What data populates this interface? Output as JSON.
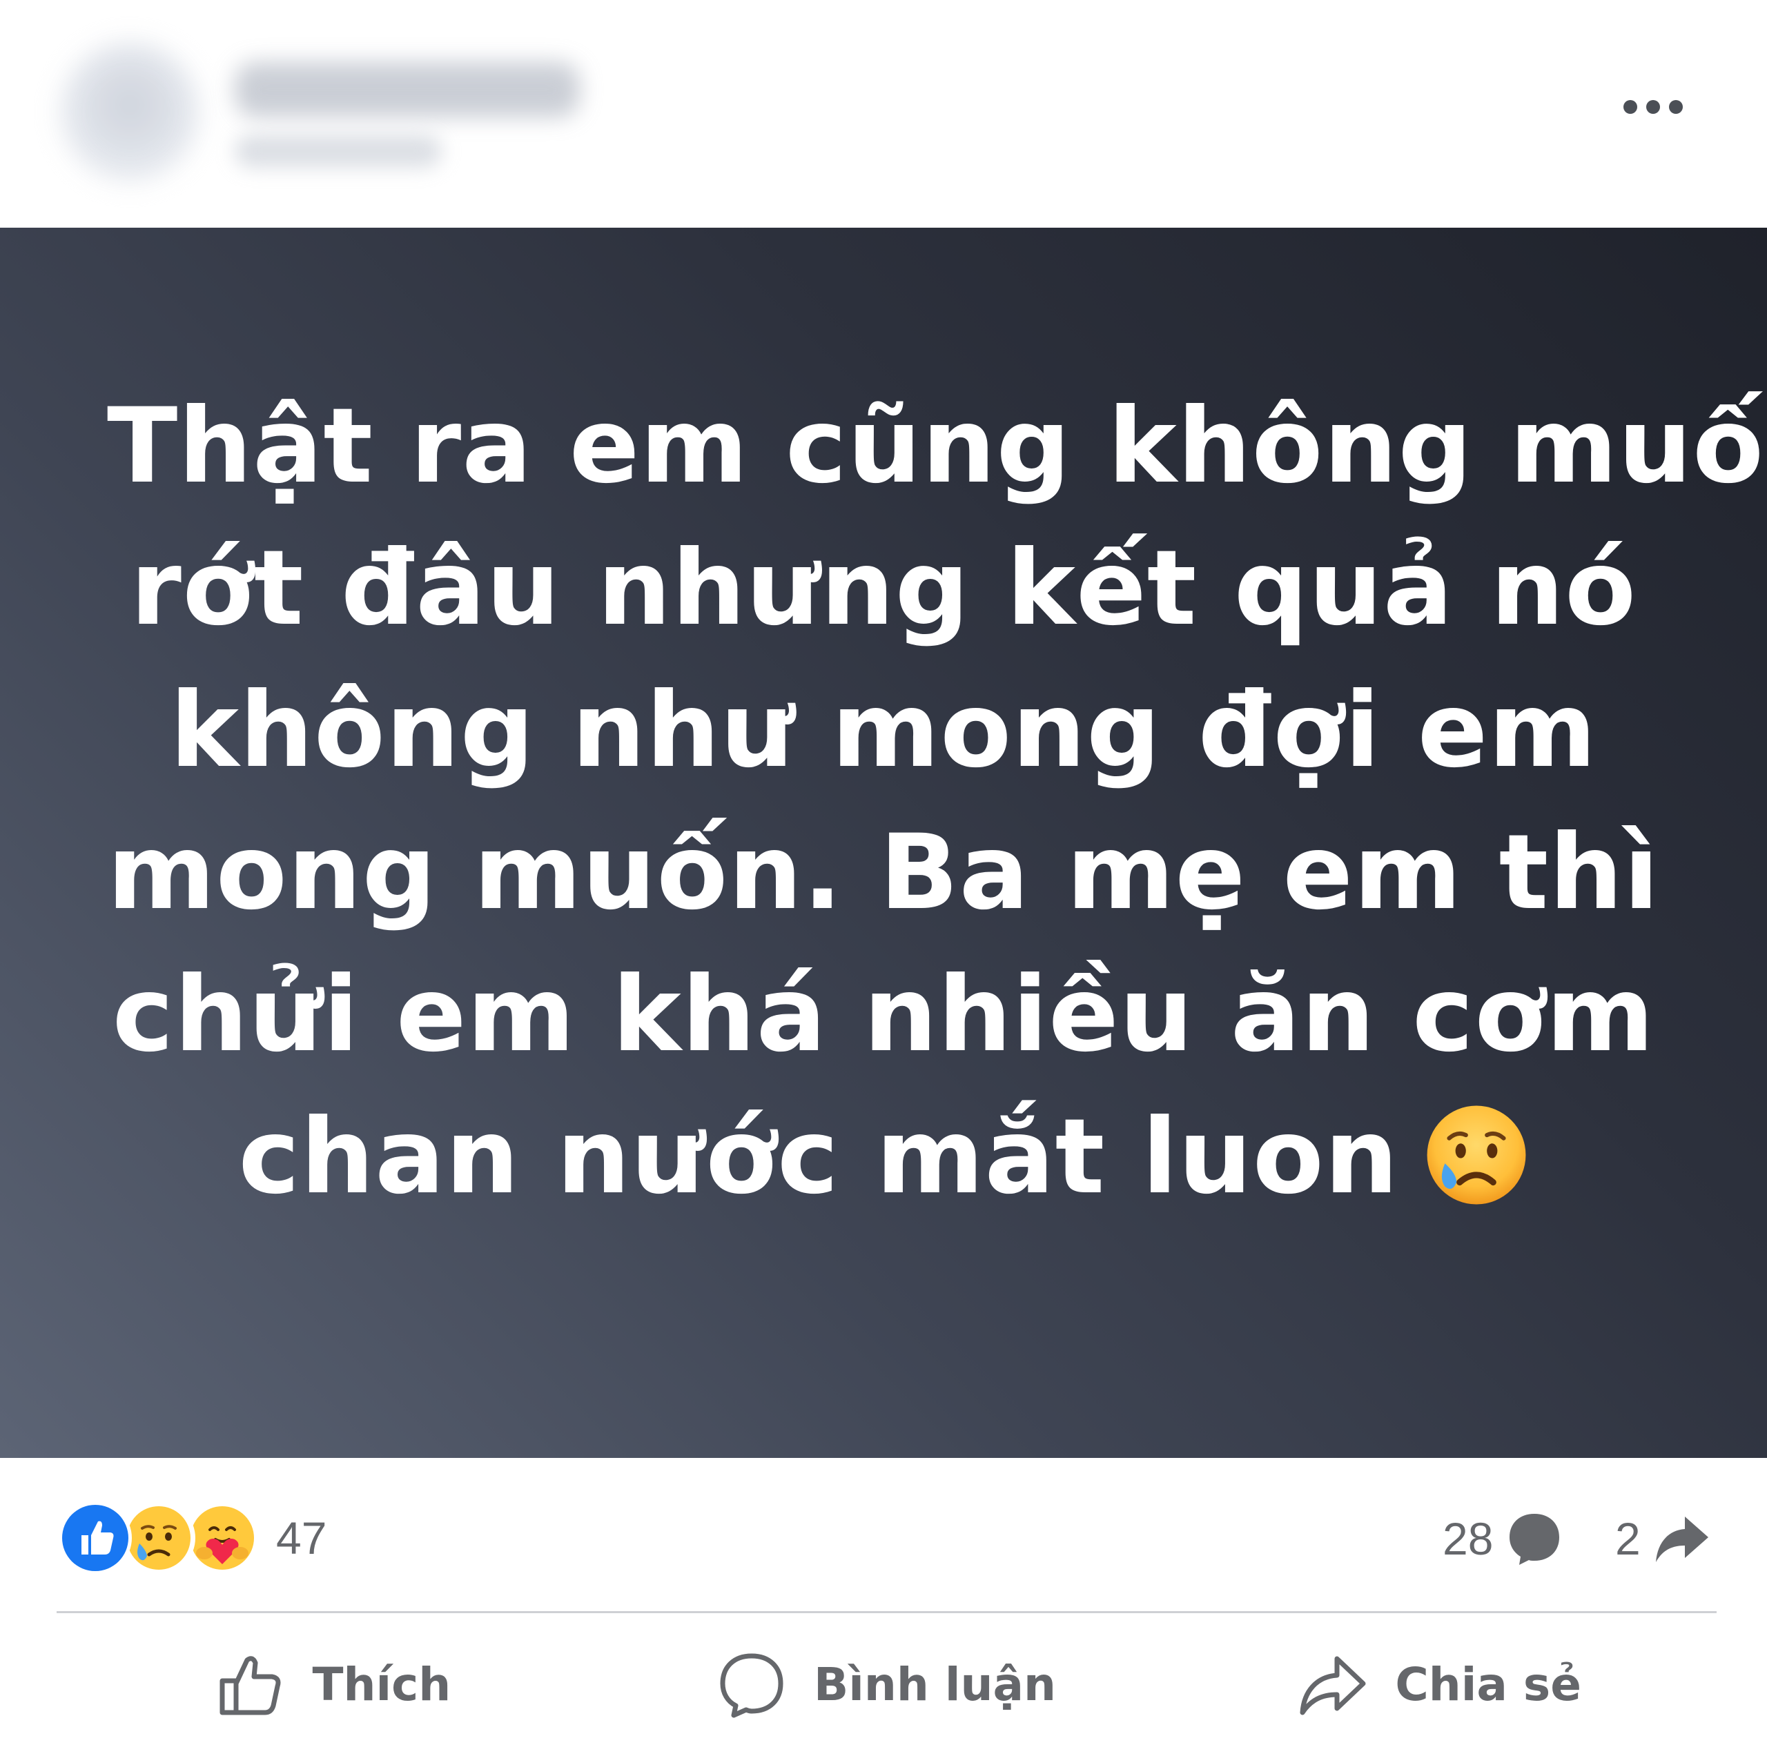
{
  "header": {
    "author_icon": "avatar-blurred",
    "more_icon": "more-dots-icon"
  },
  "post": {
    "background_colors": [
      "#5c6475",
      "#1f222b"
    ],
    "text_color": "#ffffff",
    "lines": [
      "Thật ra em cũng không muốn",
      "rớt đâu nhưng kết quả nó",
      "không như mong đợi em",
      "mong muốn. Ba mẹ em thì",
      "chửi em khá nhiều ăn cơm",
      "chan nước mắt luon"
    ],
    "emoji_icon": "crying-sad-face-icon"
  },
  "reactions": {
    "icons": [
      "like-icon",
      "sad-icon",
      "care-icon"
    ],
    "count": "47",
    "comments_count": "28",
    "shares_count": "2",
    "like_color": "#1877f2",
    "muted_text_color": "#65676b"
  },
  "actions": {
    "like_label": "Thích",
    "comment_label": "Bình luận",
    "share_label": "Chia sẻ"
  }
}
